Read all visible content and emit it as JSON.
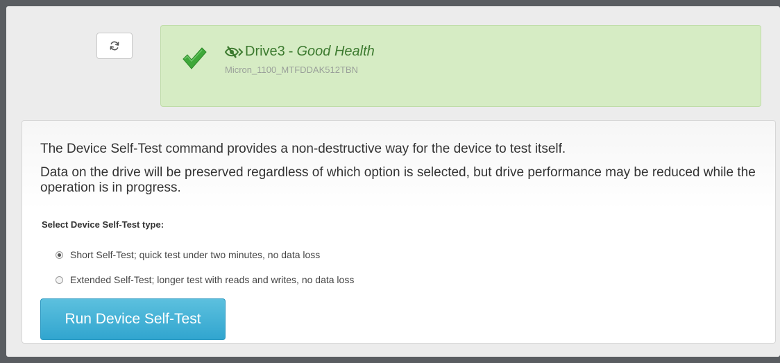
{
  "header": {
    "refresh_icon": "refresh-icon",
    "status": {
      "icon": "check-icon",
      "drive_name": "Drive3",
      "separator": "-",
      "health": "Good Health",
      "model": "Micron_1100_MTFDDAK512TBN",
      "color": "#3c7a2f",
      "background": "#d6ecc4"
    }
  },
  "main": {
    "description1": "The Device Self-Test command provides a non-destructive way for the device to test itself.",
    "description2": "Data on the drive will be preserved regardless of which option is selected, but drive performance may be reduced while the operation is in progress.",
    "select_label": "Select Device Self-Test type:",
    "options": [
      {
        "label": "Short Self-Test; quick test under two minutes, no data loss",
        "checked": true
      },
      {
        "label": "Extended Self-Test; longer test with reads and writes, no data loss",
        "checked": false
      }
    ],
    "run_button": "Run Device Self-Test",
    "accent_color": "#31a5cf"
  }
}
